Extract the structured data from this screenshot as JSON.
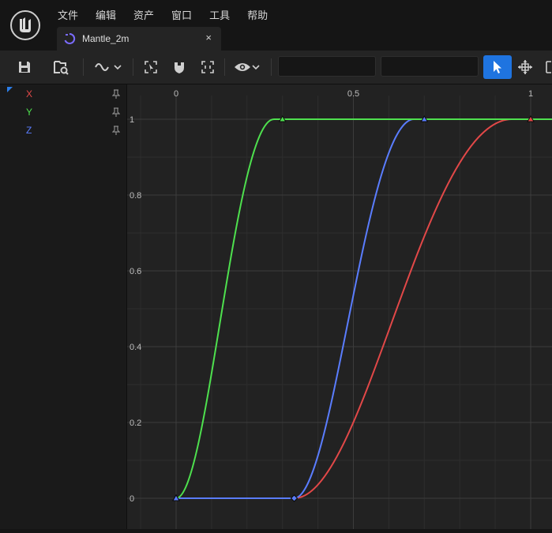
{
  "menu": {
    "items": [
      "文件",
      "编辑",
      "资产",
      "窗口",
      "工具",
      "帮助"
    ]
  },
  "tab": {
    "title": "Mantle_2m",
    "close": "×"
  },
  "curves": [
    {
      "name": "X",
      "color": "#e24848"
    },
    {
      "name": "Y",
      "color": "#4ee04e"
    },
    {
      "name": "Z",
      "color": "#5a7dff"
    }
  ],
  "chart_data": {
    "type": "line",
    "x_ticks": [
      "0",
      "0.5",
      "1"
    ],
    "y_ticks": [
      "0",
      "0.2",
      "0.4",
      "0.6",
      "0.8",
      "1"
    ],
    "xlim": [
      -0.14,
      1.06
    ],
    "ylim": [
      -0.02,
      1.06
    ],
    "grid": true,
    "series": [
      {
        "name": "X",
        "color": "#e24848",
        "keys": [
          {
            "x": 0.0,
            "y": 0
          },
          {
            "x": 0.333,
            "y": 0
          },
          {
            "x": 1.0,
            "y": 1
          }
        ]
      },
      {
        "name": "Y",
        "color": "#4ee04e",
        "keys": [
          {
            "x": 0.0,
            "y": 0
          },
          {
            "x": 0.3,
            "y": 1
          },
          {
            "x": 1.06,
            "y": 1
          }
        ]
      },
      {
        "name": "Z",
        "color": "#5a7dff",
        "keys": [
          {
            "x": 0.0,
            "y": 0
          },
          {
            "x": 0.333,
            "y": 0
          },
          {
            "x": 0.7,
            "y": 1
          },
          {
            "x": 1.06,
            "y": 1
          }
        ]
      }
    ]
  }
}
